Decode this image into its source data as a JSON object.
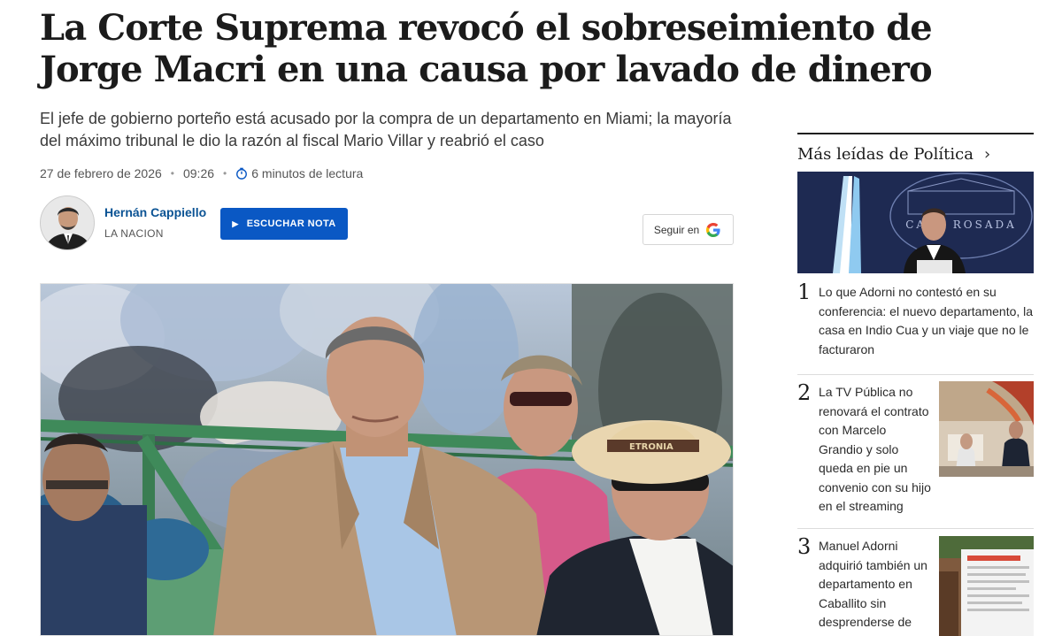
{
  "article": {
    "headline": "La Corte Suprema revocó el sobreseimiento de Jorge Macri en una causa por lavado de dinero",
    "subtitle": "El jefe de gobierno porteño está acusado por la compra de un departamento en Miami; la mayoría del máximo tribunal le dio la razón al fiscal Mario Villar y reabrió el caso",
    "date": "27 de febrero de 2026",
    "time": "09:26",
    "reading_time": "6 minutos de lectura",
    "author_name": "Hernán Cappiello",
    "author_org": "LA NACION",
    "listen_label": "ESCUCHAR NOTA",
    "follow_label": "Seguir en"
  },
  "sidebar": {
    "title": "Más leídas de Política",
    "image_banner_text": "CASA ROSADA",
    "items": [
      {
        "number": "1",
        "text": "Lo que Adorni no contestó en su conferencia: el nuevo departamento, la casa en Indio Cua y un viaje que no le facturaron"
      },
      {
        "number": "2",
        "text": "La TV Pública no renovará el contrato con Marcelo Grandio y solo queda en pie un convenio con su hijo en el streaming"
      },
      {
        "number": "3",
        "text": "Manuel Adorni adquirió también un departamento en Caballito sin desprenderse de"
      }
    ]
  },
  "photo": {
    "hat_band_text": "ETRONIA"
  },
  "colors": {
    "link_blue": "#0b5394",
    "button_blue": "#0a58c4"
  }
}
